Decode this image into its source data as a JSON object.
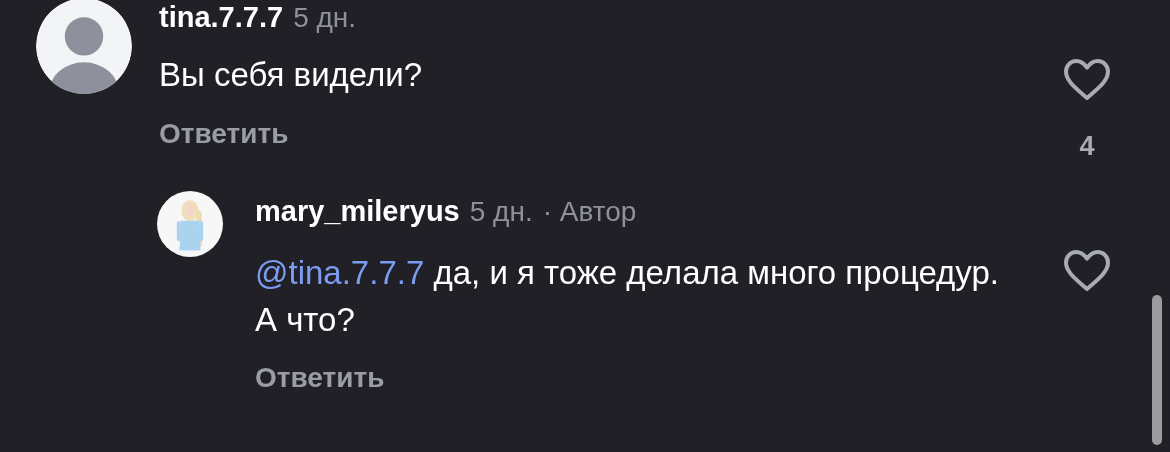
{
  "comments": [
    {
      "username": "tina.7.7.7",
      "time": "5 дн.",
      "avatar": {
        "kind": "placeholder"
      },
      "text": "Вы себя видели?",
      "reply": "Ответить",
      "liked": false,
      "likes": "4",
      "replies": [
        {
          "username": "mary_mileryus",
          "time": "5 дн.",
          "author": "· Автор",
          "mention": "@tina.7.7.7",
          "text": "да, и я тоже делала много процедур. А что?",
          "reply": "Ответить",
          "liked": false
        }
      ]
    }
  ]
}
